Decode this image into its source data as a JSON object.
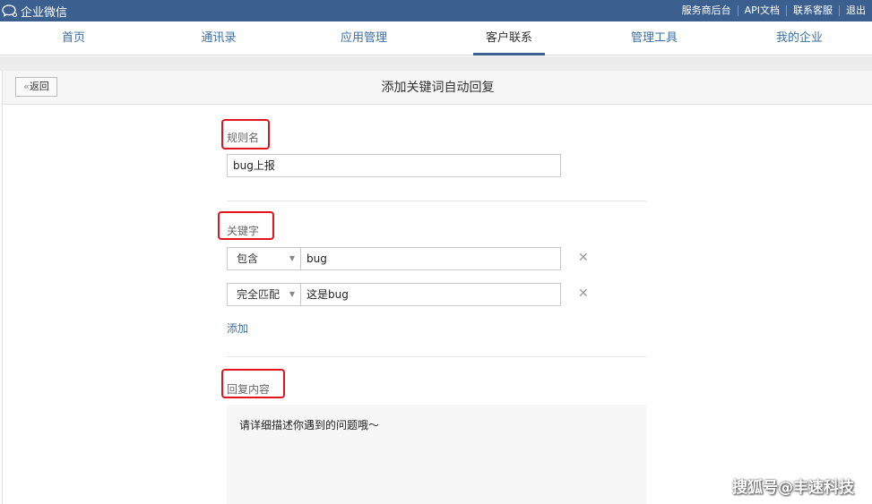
{
  "app": {
    "name": "企业微信"
  },
  "top_links": [
    "服务商后台",
    "API文档",
    "联系客服",
    "退出"
  ],
  "nav": {
    "items": [
      "首页",
      "通讯录",
      "应用管理",
      "客户联系",
      "管理工具",
      "我的企业"
    ],
    "active": "客户联系"
  },
  "page": {
    "back_label": "返回",
    "title": "添加关键词自动回复"
  },
  "rule": {
    "label": "规则名",
    "value": "bug上报"
  },
  "keywords": {
    "label": "关键字",
    "rows": [
      {
        "match": "包含",
        "value": "bug"
      },
      {
        "match": "完全匹配",
        "value": "这是bug"
      }
    ],
    "add_label": "添加"
  },
  "reply": {
    "label": "回复内容",
    "value": "请详细描述你遇到的问题哦～"
  },
  "watermark": "搜狐号@丰速科技",
  "colors": {
    "topbar": "#3b5f8f",
    "link": "#3b6fa6",
    "highlight": "#e3141b"
  }
}
